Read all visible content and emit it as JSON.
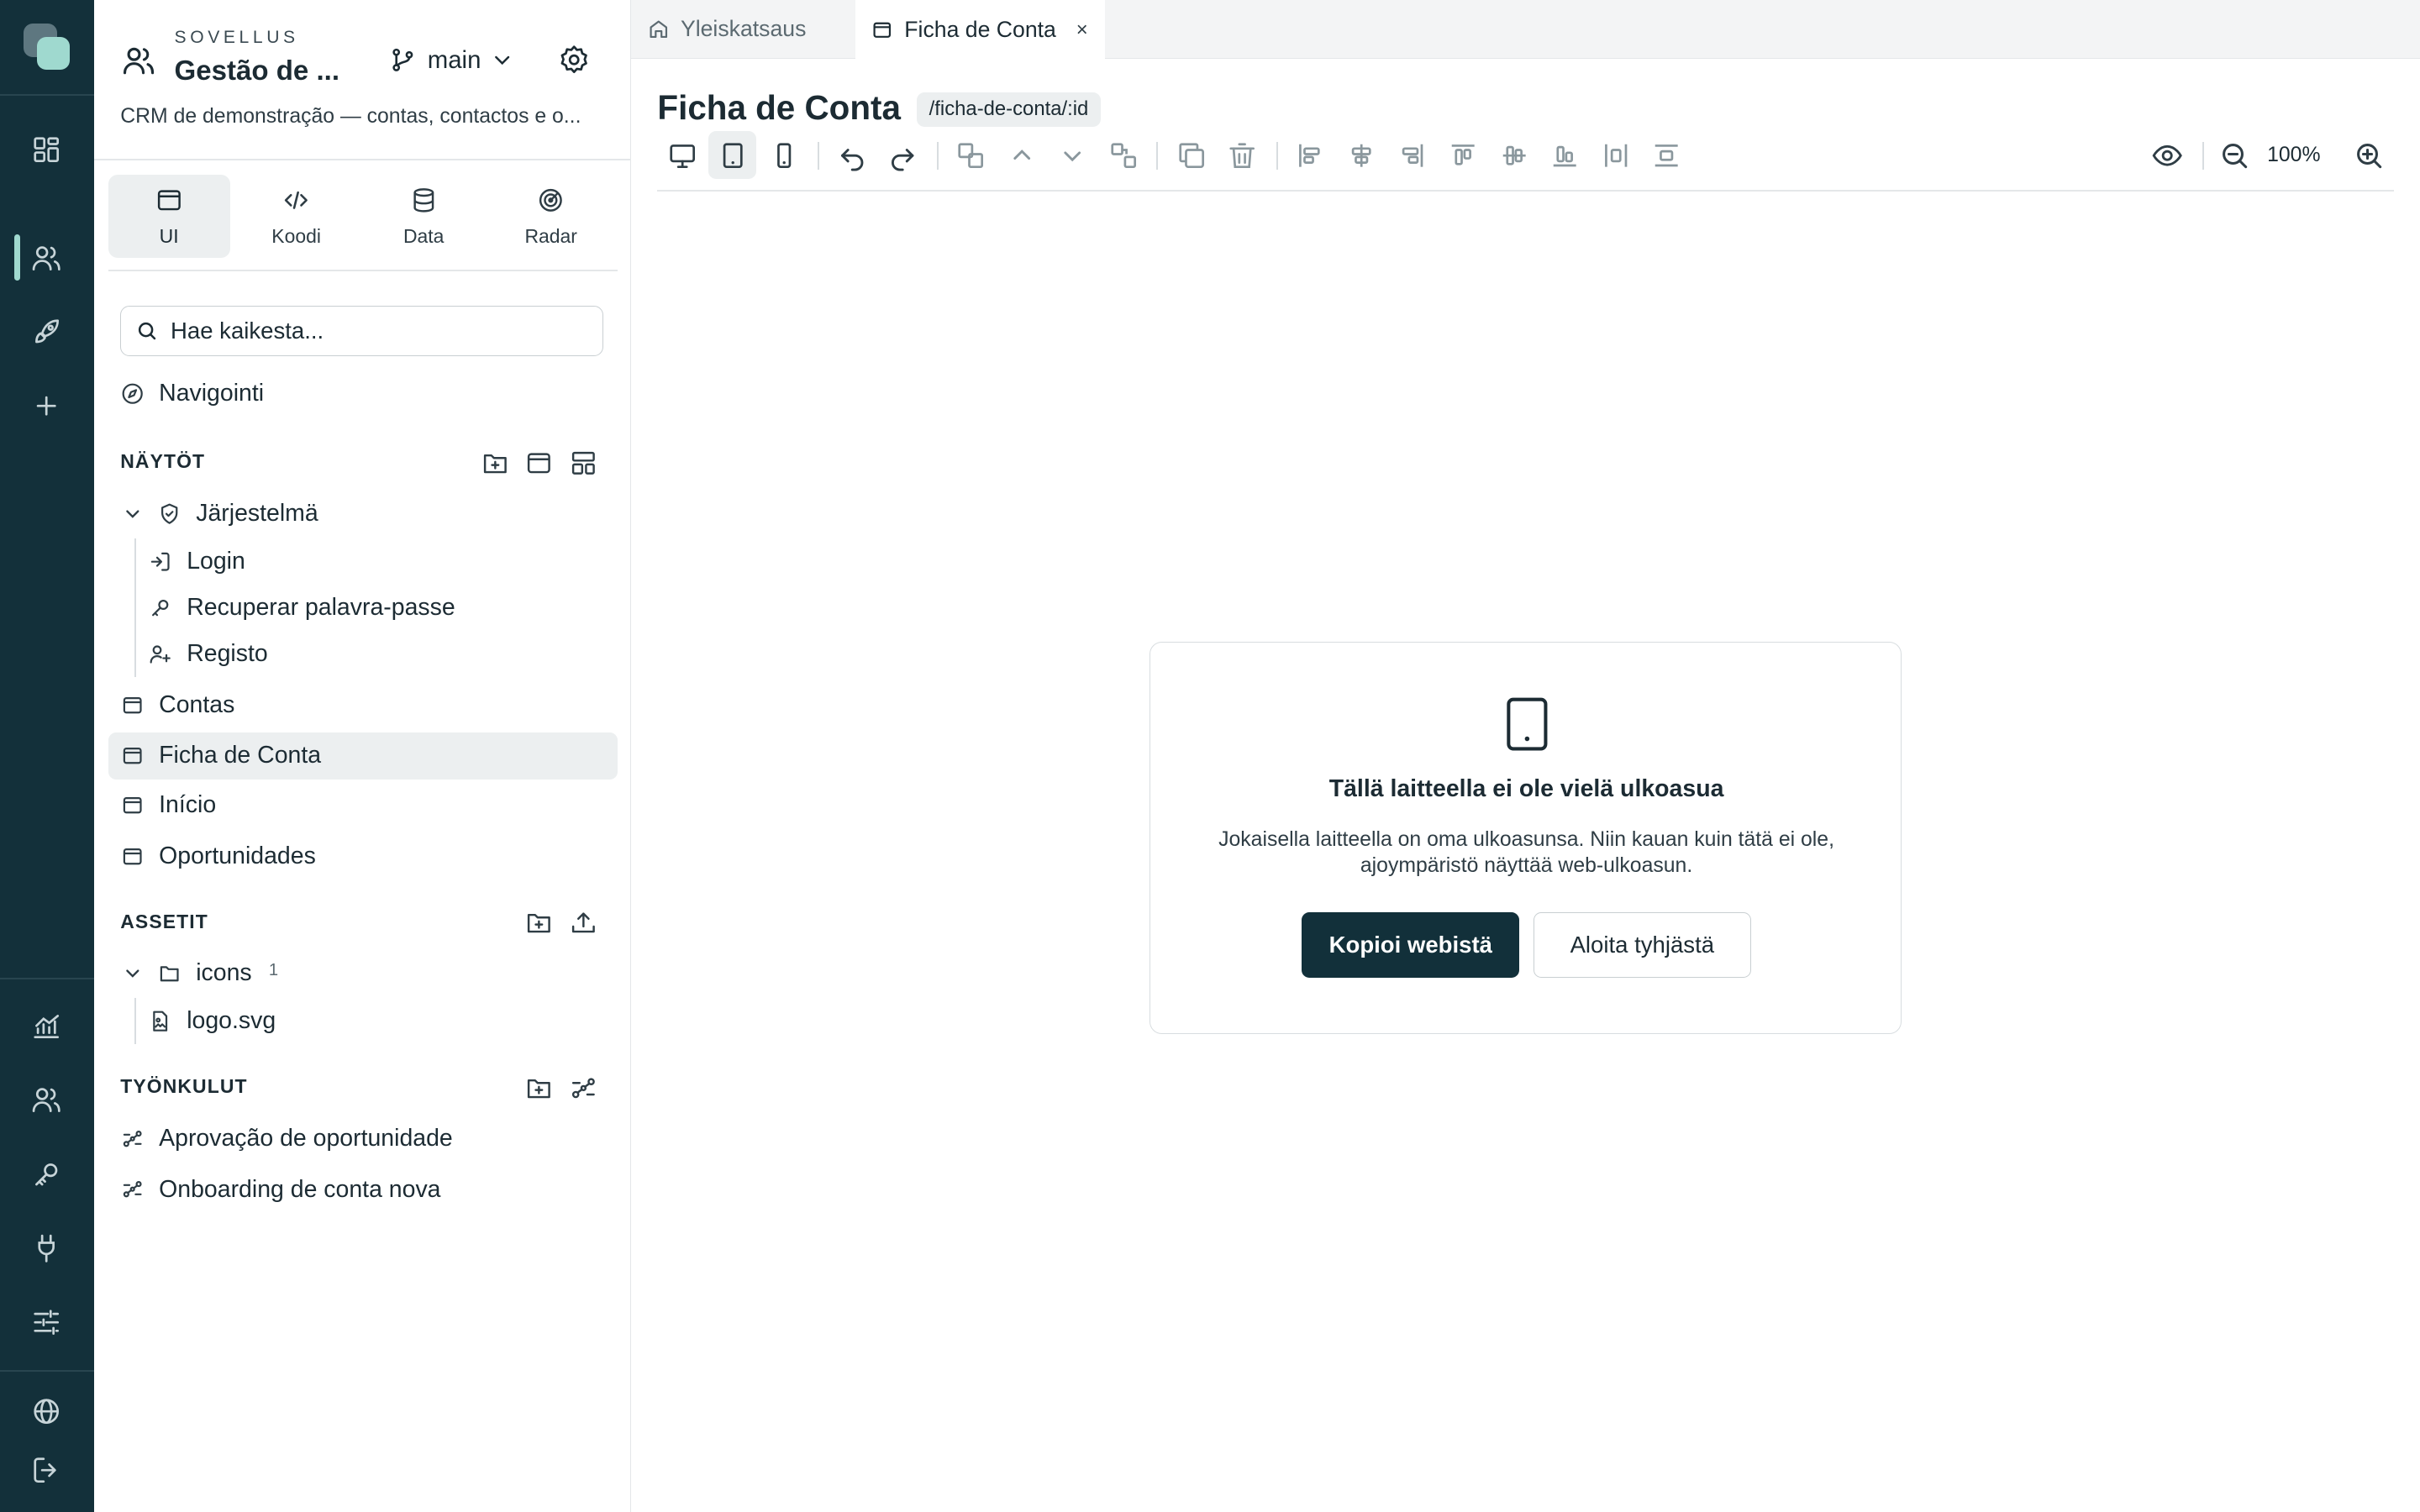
{
  "colors": {
    "rail_bg": "#13303a",
    "accent": "#9fd9cf",
    "primary_button": "#12303a",
    "active_bg": "#eceff0"
  },
  "rail": {
    "items": [
      "dashboard-icon",
      "users-icon",
      "rocket-icon",
      "plus-icon",
      "chart-icon",
      "team-icon",
      "key-icon",
      "plug-icon",
      "sliders-icon",
      "globe-icon",
      "logout-icon"
    ],
    "active": "users-icon"
  },
  "project": {
    "eyebrow": "SOVELLUS",
    "title": "Gestão de ...",
    "branch": "main",
    "description": "CRM de demonstração — contas, contactos e o..."
  },
  "mode_tabs": [
    {
      "label": "UI",
      "icon": "window-icon",
      "active": true
    },
    {
      "label": "Koodi",
      "icon": "code-icon",
      "active": false
    },
    {
      "label": "Data",
      "icon": "database-icon",
      "active": false
    },
    {
      "label": "Radar",
      "icon": "radar-icon",
      "active": false
    }
  ],
  "search": {
    "placeholder": "Hae kaikesta..."
  },
  "navigation": {
    "label": "Navigointi"
  },
  "screens": {
    "title": "NÄYTÖT",
    "folder": "Järjestelmä",
    "folder_items": [
      "Login",
      "Recuperar palavra-passe",
      "Registo"
    ],
    "items": [
      "Contas",
      "Ficha de Conta",
      "Início",
      "Oportunidades"
    ],
    "active": "Ficha de Conta"
  },
  "assets": {
    "title": "ASSETIT",
    "folder": "icons",
    "folder_count": "1",
    "file": "logo.svg"
  },
  "workflows": {
    "title": "TYÖNKULUT",
    "items": [
      "Aprovação de oportunidade",
      "Onboarding de conta nova"
    ]
  },
  "editor_tabs": [
    {
      "label": "Yleiskatsaus",
      "icon": "home-icon",
      "active": false
    },
    {
      "label": "Ficha de Conta",
      "icon": "window-icon",
      "active": true,
      "close": "×"
    }
  ],
  "page": {
    "title": "Ficha de Conta",
    "route": "/ficha-de-conta/:id"
  },
  "toolbar": {
    "zoom": "100%",
    "active_device": "tablet"
  },
  "empty_state": {
    "title": "Tällä laitteella ei ole vielä ulkoasua",
    "body": "Jokaisella laitteella on oma ulkoasunsa. Niin kauan kuin tätä ei ole, ajoympäristö näyttää web-ulkoasun.",
    "primary": "Kopioi webistä",
    "secondary": "Aloita tyhjästä"
  }
}
